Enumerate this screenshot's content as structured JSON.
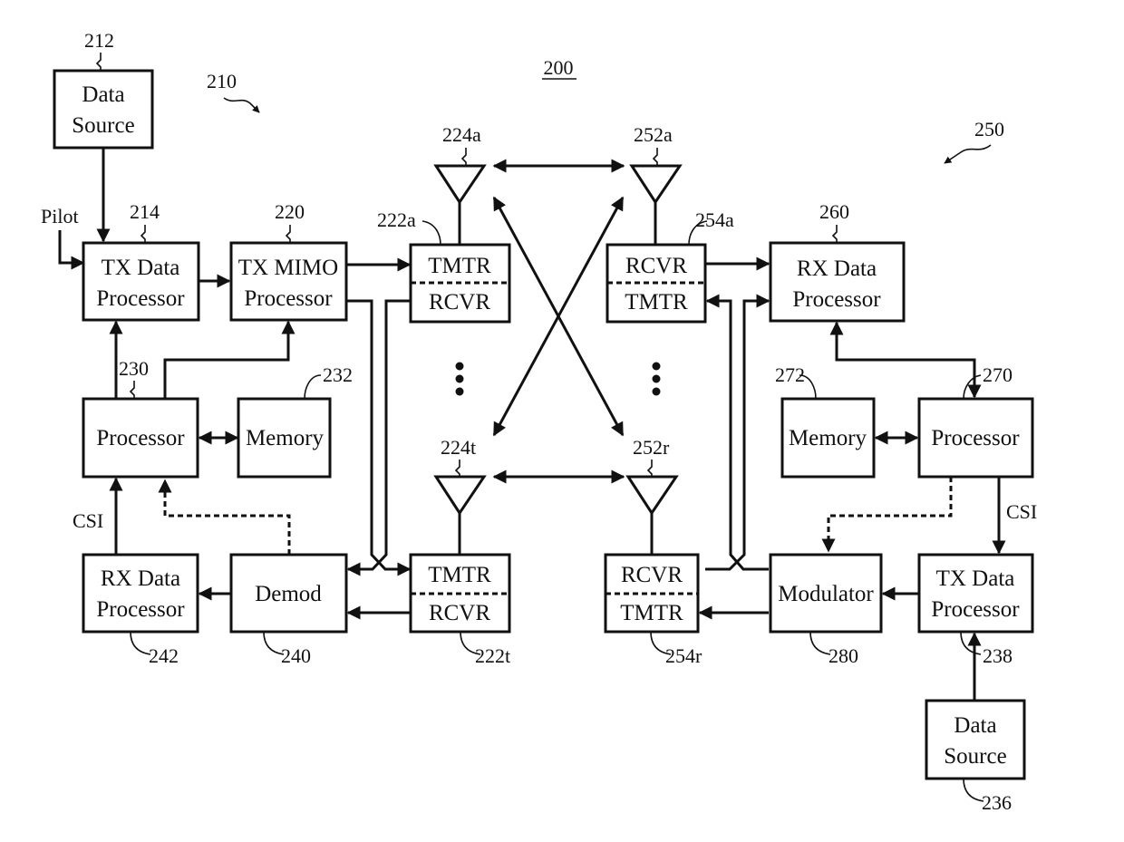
{
  "figure": {
    "number": "200",
    "transmitter_ref": "210",
    "receiver_ref": "250",
    "accent_color": "#111111"
  },
  "transmitter": {
    "data_source": {
      "ref": "212",
      "line1": "Data",
      "line2": "Source"
    },
    "pilot_label": "Pilot",
    "tx_data_processor": {
      "ref": "214",
      "line1": "TX Data",
      "line2": "Processor"
    },
    "tx_mimo_processor": {
      "ref": "220",
      "line1": "TX MIMO",
      "line2": "Processor"
    },
    "processor": {
      "ref": "230",
      "label": "Processor"
    },
    "memory": {
      "ref": "232",
      "label": "Memory"
    },
    "csi_label": "CSI",
    "rx_data_processor": {
      "ref": "242",
      "line1": "RX Data",
      "line2": "Processor"
    },
    "demod": {
      "ref": "240",
      "label": "Demod"
    },
    "transceiver_a": {
      "ref": "222a",
      "top": "TMTR",
      "bottom": "RCVR"
    },
    "transceiver_t": {
      "ref": "222t",
      "top": "TMTR",
      "bottom": "RCVR"
    },
    "antenna_a": {
      "ref": "224a"
    },
    "antenna_t": {
      "ref": "224t"
    }
  },
  "receiver": {
    "antenna_a": {
      "ref": "252a"
    },
    "antenna_r": {
      "ref": "252r"
    },
    "transceiver_a": {
      "ref": "254a",
      "top": "RCVR",
      "bottom": "TMTR"
    },
    "transceiver_r": {
      "ref": "254r",
      "top": "RCVR",
      "bottom": "TMTR"
    },
    "rx_data_processor": {
      "ref": "260",
      "line1": "RX Data",
      "line2": "Processor"
    },
    "memory": {
      "ref": "272",
      "label": "Memory"
    },
    "processor": {
      "ref": "270",
      "label": "Processor"
    },
    "csi_label": "CSI",
    "modulator": {
      "ref": "280",
      "label": "Modulator"
    },
    "tx_data_processor": {
      "ref": "238",
      "line1": "TX Data",
      "line2": "Processor"
    },
    "data_source": {
      "ref": "236",
      "line1": "Data",
      "line2": "Source"
    }
  }
}
